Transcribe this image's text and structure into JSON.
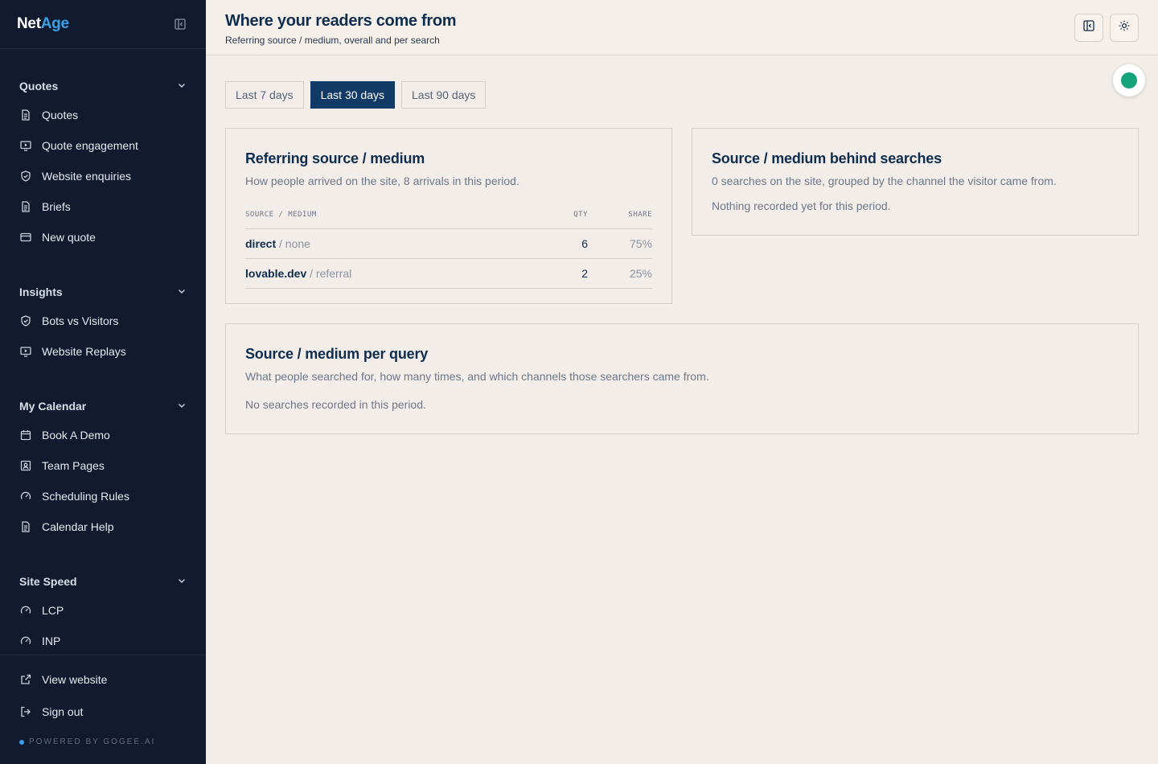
{
  "brand": {
    "part1": "Net",
    "part2": "Age"
  },
  "sidebar": {
    "groups": [
      {
        "label": "Quotes",
        "items": [
          {
            "label": "Quotes",
            "icon": "document-icon"
          },
          {
            "label": "Quote engagement",
            "icon": "monitor-play-icon"
          },
          {
            "label": "Website enquiries",
            "icon": "shield-check-icon"
          },
          {
            "label": "Briefs",
            "icon": "document-icon"
          },
          {
            "label": "New quote",
            "icon": "credit-card-icon"
          }
        ]
      },
      {
        "label": "Insights",
        "items": [
          {
            "label": "Bots vs Visitors",
            "icon": "shield-check-icon"
          },
          {
            "label": "Website Replays",
            "icon": "monitor-play-icon"
          }
        ]
      },
      {
        "label": "My Calendar",
        "items": [
          {
            "label": "Book A Demo",
            "icon": "calendar-icon"
          },
          {
            "label": "Team Pages",
            "icon": "contact-icon"
          },
          {
            "label": "Scheduling Rules",
            "icon": "gauge-icon"
          },
          {
            "label": "Calendar Help",
            "icon": "document-icon"
          }
        ]
      },
      {
        "label": "Site Speed",
        "items": [
          {
            "label": "LCP",
            "icon": "gauge-icon"
          },
          {
            "label": "INP",
            "icon": "gauge-icon"
          }
        ]
      }
    ],
    "footer": {
      "view_website": "View website",
      "sign_out": "Sign out",
      "powered_by": "POWERED BY GOGEE.AI"
    }
  },
  "header": {
    "title": "Where your readers come from",
    "subtitle": "Referring source / medium, overall and per search"
  },
  "tabs": [
    {
      "label": "Last 7 days",
      "active": false
    },
    {
      "label": "Last 30 days",
      "active": true
    },
    {
      "label": "Last 90 days",
      "active": false
    }
  ],
  "cards": {
    "referring": {
      "title": "Referring source / medium",
      "description": "How people arrived on the site, 8 arrivals in this period.",
      "columns": {
        "source": "SOURCE / MEDIUM",
        "qty": "QTY",
        "share": "SHARE"
      },
      "rows": [
        {
          "source": "direct",
          "medium": "/ none",
          "qty": "6",
          "share": "75%"
        },
        {
          "source": "lovable.dev",
          "medium": "/ referral",
          "qty": "2",
          "share": "25%"
        }
      ]
    },
    "searches": {
      "title": "Source / medium behind searches",
      "description": "0 searches on the site, grouped by the channel the visitor came from.",
      "empty": "Nothing recorded yet for this period."
    },
    "per_query": {
      "title": "Source / medium per query",
      "description": "What people searched for, how many times, and which channels those searchers came from.",
      "empty": "No searches recorded in this period."
    }
  },
  "colors": {
    "sidebar_bg": "#111a2e",
    "accent": "#113a66",
    "brand_accent": "#3aa0e8",
    "status": "#14a37a"
  }
}
